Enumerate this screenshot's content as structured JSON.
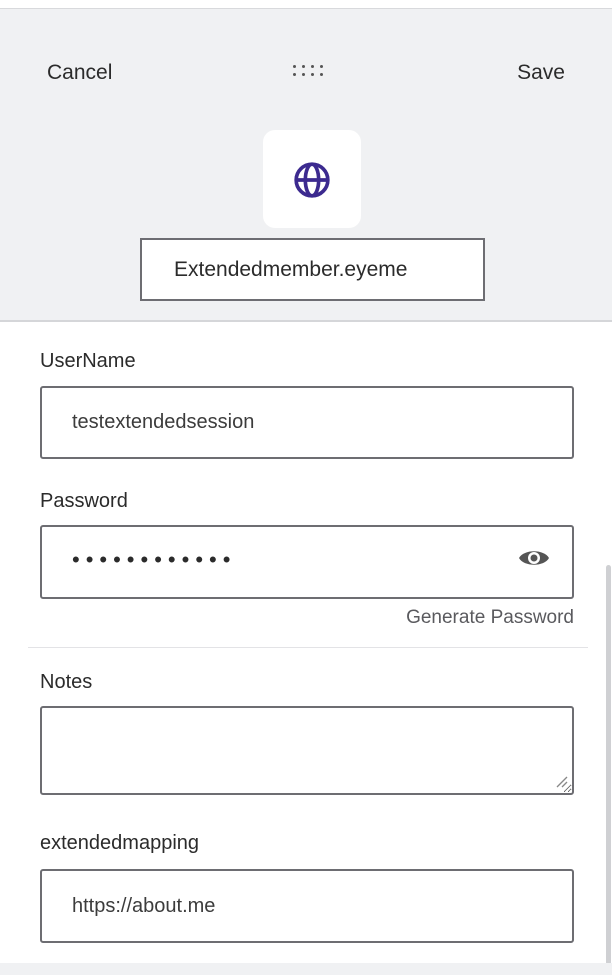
{
  "header": {
    "cancel_label": "Cancel",
    "save_label": "Save",
    "drag_handle_icon": "drag-dots-icon",
    "site_icon": "globe-icon",
    "site_icon_color": "#3c2a8f",
    "title_value": "Extendedmember.eyeme"
  },
  "form": {
    "username": {
      "label": "UserName",
      "value": "testextendedsession"
    },
    "password": {
      "label": "Password",
      "masked_value": "••••••••••••",
      "toggle_icon": "eye-icon",
      "generate_label": "Generate Password"
    },
    "notes": {
      "label": "Notes",
      "value": ""
    },
    "extended_mapping": {
      "label": "extendedmapping",
      "value": "https://about.me"
    }
  },
  "colors": {
    "header_bg": "#f0f1f3",
    "border": "#6d6d72",
    "text": "#2b2b2b",
    "link": "#5a5a5e"
  }
}
